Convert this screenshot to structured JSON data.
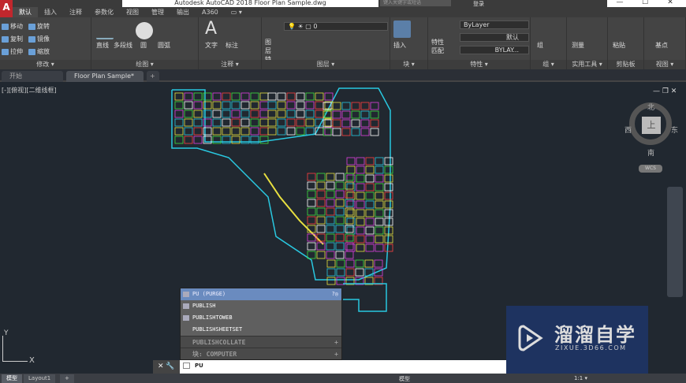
{
  "app": {
    "title": "Autodesk AutoCAD 2018    Floor Plan Sample.dwg",
    "logo": "A",
    "search_placeholder": "键入关键字或短语",
    "user": "登录",
    "window_controls": [
      "—",
      "☐",
      "✕"
    ]
  },
  "ribbon_tabs": [
    "默认",
    "插入",
    "注释",
    "参数化",
    "视图",
    "管理",
    "输出",
    "A360",
    "▭ ▾"
  ],
  "panels": {
    "modify": {
      "label": "修改 ▾",
      "tools": [
        "移动",
        "旋转",
        "复制",
        "镜像",
        "拉伸",
        "缩放"
      ]
    },
    "draw": {
      "label": "绘图 ▾",
      "tools": [
        "直线",
        "多段线",
        "圆",
        "圆弧"
      ]
    },
    "annotation": {
      "label": "注释 ▾",
      "tools": [
        "文字",
        "标注"
      ]
    },
    "layers": {
      "label": "图层 ▾",
      "tools": [
        "图层特性"
      ],
      "layer_value": "0"
    },
    "block": {
      "label": "块 ▾",
      "tools": [
        "插入"
      ]
    },
    "properties": {
      "label": "特性 ▾",
      "tools": [
        "特性匹配"
      ],
      "color": "ByLayer",
      "linetype": "默认",
      "lineweight": "BYLAY..."
    },
    "groups": {
      "label": "组 ▾",
      "tools": [
        "组"
      ]
    },
    "utilities": {
      "label": "实用工具 ▾",
      "tools": [
        "测量"
      ]
    },
    "clipboard": {
      "label": "剪贴板",
      "tools": [
        "粘贴"
      ]
    },
    "view": {
      "label": "视图 ▾",
      "tools": [
        "基点"
      ]
    }
  },
  "file_tabs": [
    "开始",
    "Floor Plan Sample*",
    "+"
  ],
  "viewport": {
    "label": "[-][俯视][二维线框]",
    "controls": "— ❐ ✕"
  },
  "viewcube": {
    "north": "北",
    "south": "南",
    "east": "东",
    "west": "西",
    "face": "上",
    "wcs": "WCS"
  },
  "ucs": {
    "x": "X",
    "y": "Y"
  },
  "autocomplete": {
    "items": [
      "PU (PURGE)",
      "PUBLISH",
      "PUBLISHTOWEB",
      "PUBLISHSHEETSET"
    ],
    "categories": [
      "PUBLISHCOLLATE",
      "块: COMPUTER"
    ]
  },
  "command": {
    "input": "PU",
    "controls": "✕ 🔧"
  },
  "layout_tabs": [
    "模型",
    "Layout1",
    "+"
  ],
  "status": {
    "model": "模型",
    "scale": "1:1 ▾"
  },
  "watermark": {
    "title": "溜溜自学",
    "url": "ZIXUE.3D66.COM"
  },
  "colors": {
    "accent": "#6a8bbf",
    "cad_bg": "#212830",
    "plan_cyan": "#29c8e0",
    "plan_magenta": "#e040e0"
  }
}
